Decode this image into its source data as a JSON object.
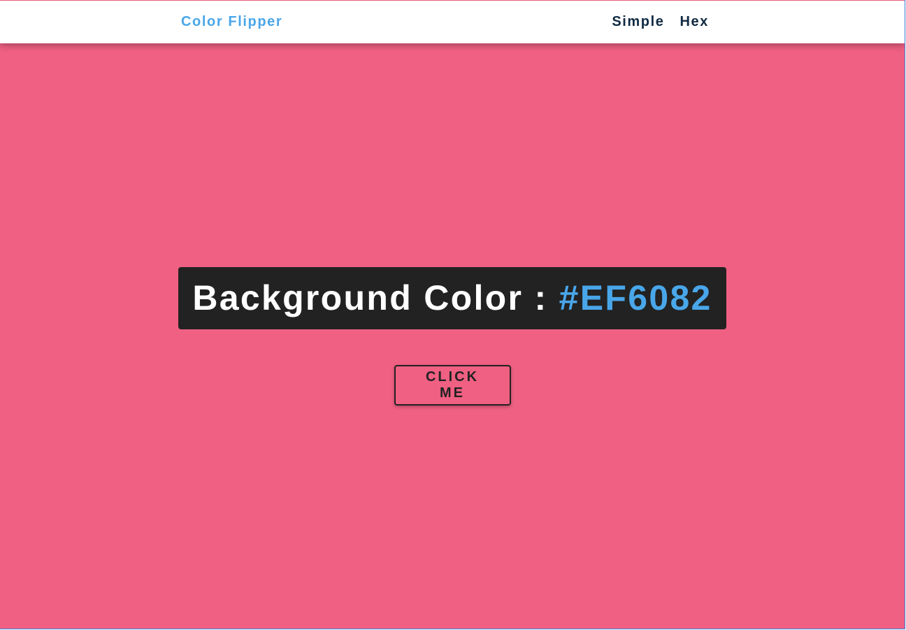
{
  "navbar": {
    "brand": "Color Flipper",
    "links": [
      {
        "label": "Simple"
      },
      {
        "label": "Hex"
      }
    ]
  },
  "main": {
    "heading_prefix": "Background Color : ",
    "color_value": "#EF6082",
    "button_label": "click me"
  },
  "colors": {
    "background": "#EF6082",
    "brand": "#49a6e9",
    "nav_text": "#102a42",
    "heading_bg": "#222222",
    "heading_text": "#ffffff",
    "button_border": "#222222"
  }
}
